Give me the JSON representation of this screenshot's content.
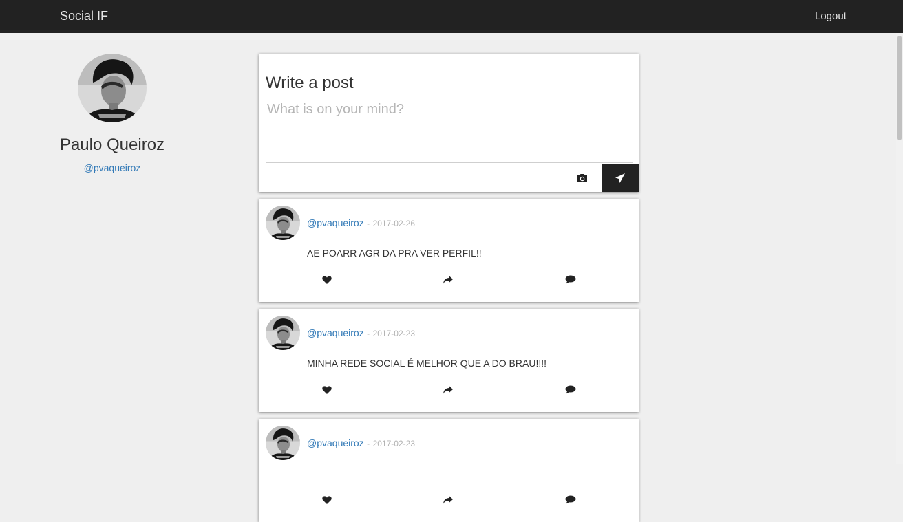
{
  "navbar": {
    "brand": "Social IF",
    "logout_label": "Logout"
  },
  "profile": {
    "name": "Paulo Queiroz",
    "handle": "@pvaqueiroz"
  },
  "composer": {
    "title": "Write a post",
    "placeholder": "What is on your mind?",
    "camera_icon": "camera-icon",
    "send_icon": "send-icon"
  },
  "posts": [
    {
      "handle": "@pvaqueiroz",
      "separator": "-",
      "date": "2017-02-26",
      "text": "AE POARR AGR DA PRA VER PERFIL!!"
    },
    {
      "handle": "@pvaqueiroz",
      "separator": "-",
      "date": "2017-02-23",
      "text": "MINHA REDE SOCIAL É MELHOR QUE A DO BRAU!!!!"
    },
    {
      "handle": "@pvaqueiroz",
      "separator": "-",
      "date": "2017-02-23",
      "text": ""
    }
  ],
  "post_actions": [
    "heart-icon",
    "share-icon",
    "comment-icon"
  ],
  "colors": {
    "navbar": "#222222",
    "background": "#efefef",
    "link": "#337ab7",
    "date": "#b3b3b3"
  }
}
